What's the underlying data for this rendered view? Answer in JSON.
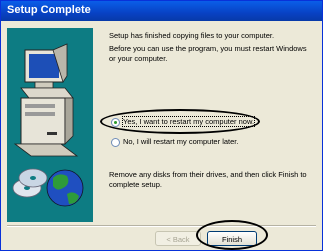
{
  "window": {
    "title": "Setup Complete"
  },
  "content": {
    "message1": "Setup has finished copying files to your computer.",
    "message2": "Before you can use the program, you must restart Windows or your computer.",
    "message3": "Remove any disks from their drives, and then click Finish to complete setup."
  },
  "options": [
    {
      "label": "Yes, I want to restart my computer now.",
      "selected": true
    },
    {
      "label": "No, I will restart my computer later.",
      "selected": false
    }
  ],
  "buttons": {
    "back": "< Back",
    "finish": "Finish"
  },
  "colors": {
    "title_bar": "#0a5ee8",
    "side_panel": "#0d7c83",
    "dialog_bg": "#ece9d8"
  }
}
